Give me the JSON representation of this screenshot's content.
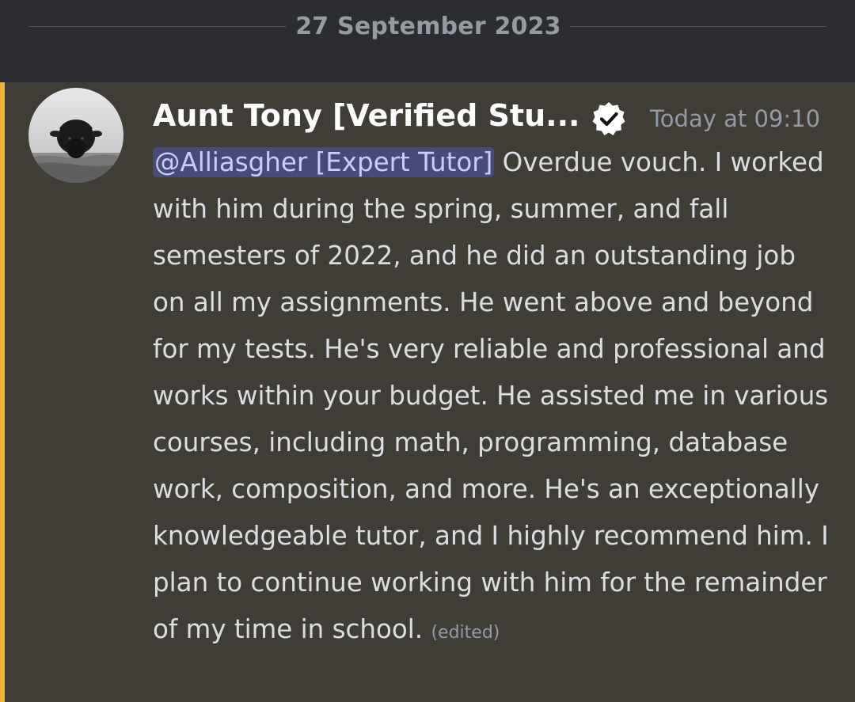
{
  "date_divider": {
    "label": "27 September 2023"
  },
  "message": {
    "author": "Aunt Tony [Verified Stu...",
    "timestamp": "Today at 09:10",
    "mention": "@Alliasgher [Expert Tutor]",
    "body": " Overdue vouch. I worked with him during the spring, summer, and fall semesters of 2022, and he did an outstanding job on all my assignments. He went above and beyond for my tests. He's very reliable and professional and works within your budget. He assisted me in various courses, including math, programming, database work, composition, and more. He's an exceptionally knowledgeable tutor, and I highly recommend him. I plan to continue working with him for the remainder of my time in school. ",
    "edited": "(edited)",
    "avatar_icon": "bull-avatar",
    "badge_icon": "verified-badge-icon"
  },
  "colors": {
    "background": "#2b2d31",
    "highlight_background": "#403d37",
    "highlight_bar": "#f0b232",
    "mention_text": "#c9cdfb",
    "timestamp": "#949ba4"
  }
}
